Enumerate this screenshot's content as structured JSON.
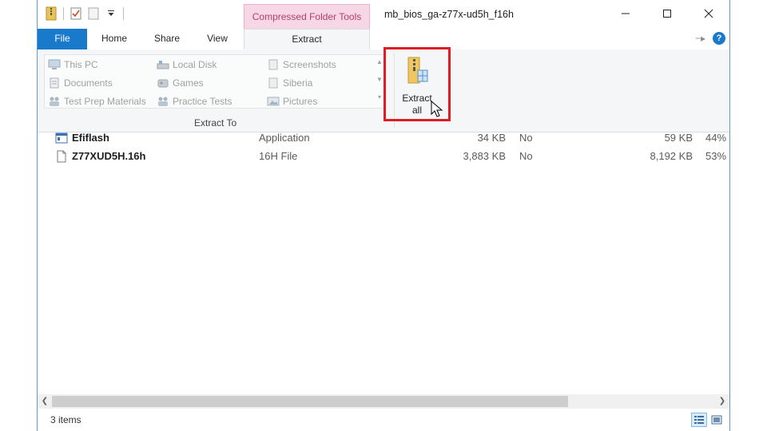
{
  "window": {
    "title": "mb_bios_ga-z77x-ud5h_f16h",
    "context_group": "Compressed Folder Tools"
  },
  "tabs": [
    {
      "label": "File"
    },
    {
      "label": "Home"
    },
    {
      "label": "Share"
    },
    {
      "label": "View"
    },
    {
      "label": "Extract"
    }
  ],
  "ribbon": {
    "extract_to": {
      "group_label": "Extract To",
      "destinations": [
        {
          "label": "This PC",
          "icon": "pc-icon"
        },
        {
          "label": "Local Disk",
          "icon": "drive-icon"
        },
        {
          "label": "Screenshots",
          "icon": "folder-icon"
        },
        {
          "label": "Documents",
          "icon": "documents-icon"
        },
        {
          "label": "Games",
          "icon": "games-icon"
        },
        {
          "label": "Siberia",
          "icon": "folder-icon"
        },
        {
          "label": "Test Prep Materials",
          "icon": "user-folder-icon"
        },
        {
          "label": "Practice Tests",
          "icon": "user-folder-icon"
        },
        {
          "label": "Pictures",
          "icon": "pictures-icon"
        }
      ]
    },
    "extract_all": {
      "line1": "Extract",
      "line2": "all"
    }
  },
  "files": [
    {
      "name": "Efiflash",
      "type": "Application",
      "compressed_size": "34 KB",
      "password_protected": "No",
      "size": "59 KB",
      "ratio": "44%",
      "icon": "application-icon"
    },
    {
      "name": "Z77XUD5H.16h",
      "type": "16H File",
      "compressed_size": "3,883 KB",
      "password_protected": "No",
      "size": "8,192 KB",
      "ratio": "53%",
      "icon": "file-icon"
    }
  ],
  "status": {
    "item_count": "3 items"
  },
  "colors": {
    "accent": "#1979ca",
    "context_tab": "#f7d6e6",
    "context_text": "#b23e70",
    "highlight": "#e01b24"
  }
}
